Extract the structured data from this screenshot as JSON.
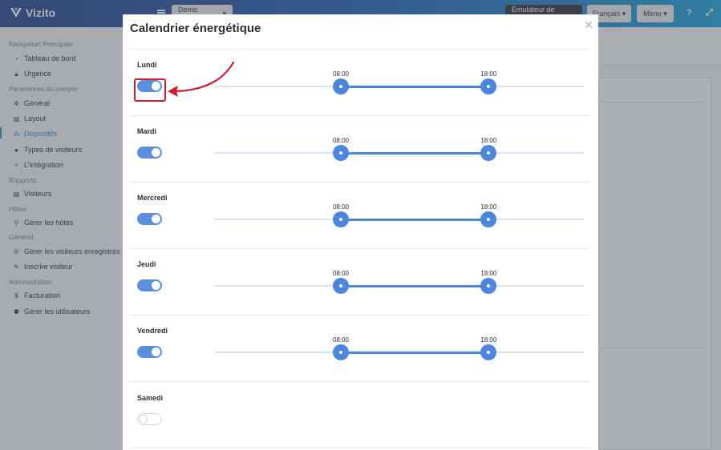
{
  "app": {
    "name": "Vizito"
  },
  "topbar": {
    "account": "Demo Account",
    "emulator": "Émulateur de tablette",
    "language": "Français",
    "menu": "Menu"
  },
  "sidebar": {
    "sections": [
      {
        "label": "Navigation Principale",
        "items": [
          {
            "label": "Tableau de bord",
            "icon": "dashboard-icon"
          },
          {
            "label": "Urgence",
            "icon": "warning-icon"
          }
        ]
      },
      {
        "label": "Paramètres du compte",
        "items": [
          {
            "label": "Général",
            "icon": "gear-icon"
          },
          {
            "label": "Layout",
            "icon": "image-icon"
          },
          {
            "label": "Dispositifs",
            "icon": "sitemap-icon",
            "active": true
          },
          {
            "label": "Types de visiteurs",
            "icon": "users-icon"
          },
          {
            "label": "L'intégration",
            "icon": "plug-icon"
          }
        ]
      },
      {
        "label": "Rapports",
        "items": [
          {
            "label": "Visiteurs",
            "icon": "list-icon"
          }
        ]
      },
      {
        "label": "Hôtes",
        "items": [
          {
            "label": "Gérer les hôtes",
            "icon": "person-icon"
          }
        ]
      },
      {
        "label": "Général",
        "items": [
          {
            "label": "Gérer les visiteurs enregistrés",
            "icon": "registered-icon"
          },
          {
            "label": "Inscrire visiteur",
            "icon": "pencil-icon"
          }
        ]
      },
      {
        "label": "Administration",
        "items": [
          {
            "label": "Facturation",
            "icon": "dollar-icon"
          },
          {
            "label": "Gérer les utilisateurs",
            "icon": "user-plus-icon"
          }
        ]
      }
    ]
  },
  "modal": {
    "title": "Calendrier énergétique",
    "days": [
      {
        "label": "Lundi",
        "enabled": true,
        "start": "08:00",
        "end": "18:00",
        "start_frac": 0.3427,
        "end_frac": 0.7426
      },
      {
        "label": "Mardi",
        "enabled": true,
        "start": "08:00",
        "end": "18:00",
        "start_frac": 0.3427,
        "end_frac": 0.7426
      },
      {
        "label": "Mercredi",
        "enabled": true,
        "start": "08:00",
        "end": "18:00",
        "start_frac": 0.3427,
        "end_frac": 0.7426
      },
      {
        "label": "Jeudi",
        "enabled": true,
        "start": "08:00",
        "end": "18:00",
        "start_frac": 0.3427,
        "end_frac": 0.7426
      },
      {
        "label": "Vendredi",
        "enabled": true,
        "start": "08:00",
        "end": "18:00",
        "start_frac": 0.3427,
        "end_frac": 0.7426
      },
      {
        "label": "Samedi",
        "enabled": false
      }
    ]
  },
  "colors": {
    "accent": "#4a86dd",
    "highlight": "#d4192a"
  }
}
